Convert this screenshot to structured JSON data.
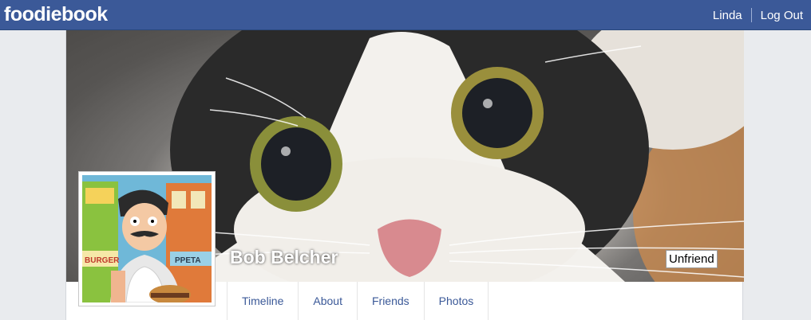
{
  "header": {
    "logo": "foodiebook",
    "user_name": "Linda",
    "logout_label": "Log Out"
  },
  "profile": {
    "name": "Bob Belcher",
    "unfriend_label": "Unfriend",
    "picture_sign_left": "BURGER",
    "picture_sign_right": "PPETA"
  },
  "tabs": [
    {
      "label": "Timeline"
    },
    {
      "label": "About"
    },
    {
      "label": "Friends"
    },
    {
      "label": "Photos"
    }
  ],
  "colors": {
    "brand": "#3b5998",
    "background": "#e9ebee"
  }
}
